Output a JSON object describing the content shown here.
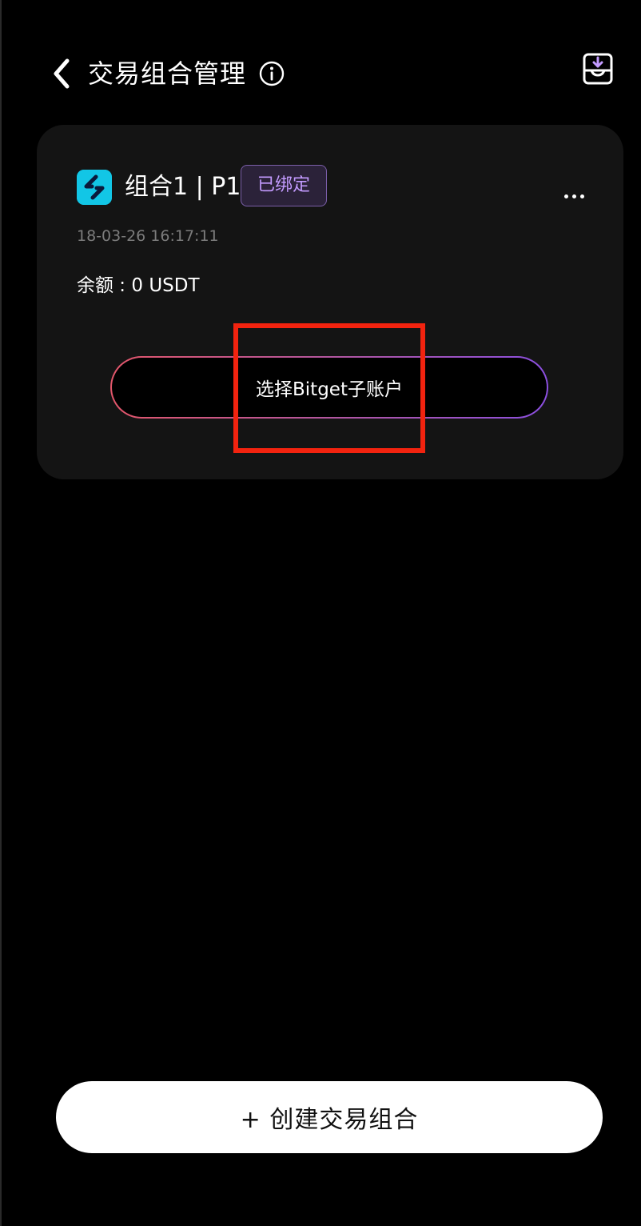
{
  "header": {
    "title": "交易组合管理",
    "back_icon": "chevron-left-icon",
    "info_icon": "info-icon",
    "export_icon": "download-tray-icon"
  },
  "card": {
    "logo_icon": "bitget-logo-icon",
    "name": "组合1 | P1",
    "badge": "已绑定",
    "more_icon": "more-horizontal-icon",
    "timestamp": "18-03-26 16:17:11",
    "balance": "余额 : 0 USDT",
    "select_button": "选择Bitget子账户"
  },
  "footer": {
    "create_button": "+ 创建交易组合"
  },
  "colors": {
    "background": "#000000",
    "card": "#141414",
    "badge_text": "#c39bff",
    "gradient_start": "#e2566a",
    "gradient_end": "#8b4fe0",
    "logo": "#12c6e6",
    "highlight": "#f2230f"
  }
}
